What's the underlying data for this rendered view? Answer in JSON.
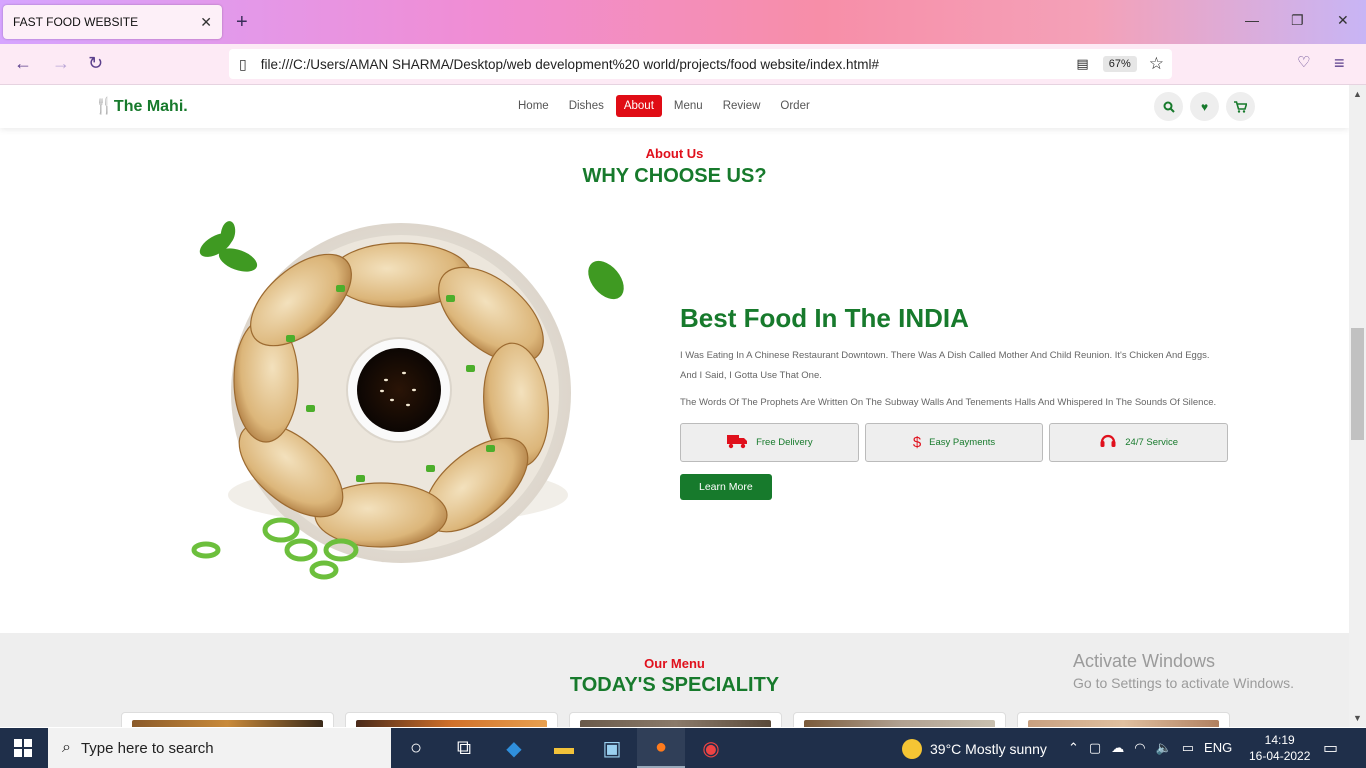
{
  "browser": {
    "tab_title": "FAST FOOD WEBSITE",
    "url": "file:///C:/Users/AMAN SHARMA/Desktop/web development%20 world/projects/food website/index.html#",
    "zoom": "67%"
  },
  "site": {
    "logo_text": "The Mahi.",
    "nav": [
      {
        "label": "Home",
        "active": false
      },
      {
        "label": "Dishes",
        "active": false
      },
      {
        "label": "About",
        "active": true
      },
      {
        "label": "Menu",
        "active": false
      },
      {
        "label": "Review",
        "active": false
      },
      {
        "label": "Order",
        "active": false
      }
    ],
    "header_icons": [
      "search-icon",
      "heart-icon",
      "cart-icon"
    ]
  },
  "about": {
    "subheading": "About Us",
    "heading": "WHY CHOOSE US?",
    "title": "Best Food In The INDIA",
    "paragraph1": "I Was Eating In A Chinese Restaurant Downtown. There Was A Dish Called Mother And Child Reunion. It's Chicken And Eggs. And I Said, I Gotta Use That One.",
    "paragraph2": "The Words Of The Prophets Are Written On The Subway Walls And Tenements Halls And Whispered In The Sounds Of Silence.",
    "features": [
      {
        "label": "Free Delivery",
        "icon": "truck-icon"
      },
      {
        "label": "Easy Payments",
        "icon": "dollar-icon"
      },
      {
        "label": "24/7 Service",
        "icon": "headset-icon"
      }
    ],
    "button": "Learn More"
  },
  "menu_section": {
    "subheading": "Our Menu",
    "heading": "TODAY'S SPECIALITY"
  },
  "watermark": {
    "line1": "Activate Windows",
    "line2": "Go to Settings to activate Windows."
  },
  "taskbar": {
    "search_placeholder": "Type here to search",
    "weather": "39°C  Mostly sunny",
    "lang": "ENG",
    "time": "14:19",
    "date": "16-04-2022"
  },
  "colors": {
    "brand_green": "#177a2c",
    "brand_red": "#e00c15"
  }
}
